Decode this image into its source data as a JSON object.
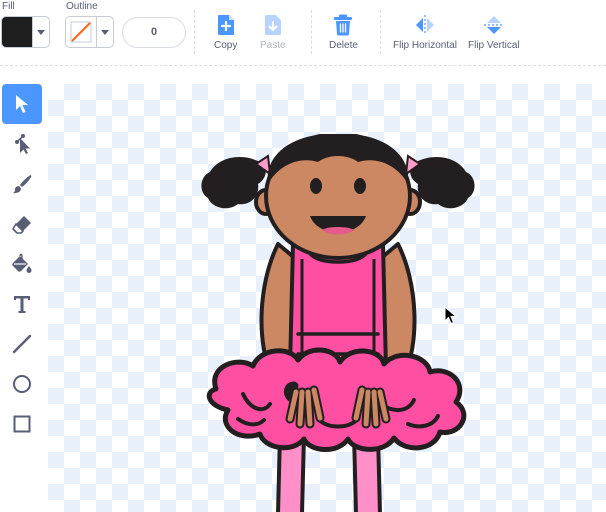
{
  "toolbar": {
    "fill_label": "Fill",
    "outline_label": "Outline",
    "fill_color": "#1e1e1e",
    "outline_color": "none",
    "outline_width": "0",
    "copy_label": "Copy",
    "paste_label": "Paste",
    "delete_label": "Delete",
    "flip_h_label": "Flip Horizontal",
    "flip_v_label": "Flip Vertical"
  },
  "palette": {
    "items": [
      "select-tool",
      "reshape-tool",
      "brush-tool",
      "eraser-tool",
      "fill-tool",
      "text-tool",
      "line-tool",
      "circle-tool",
      "rectangle-tool"
    ],
    "active": "select-tool"
  },
  "colors": {
    "accent": "#4c97ff",
    "skin": "#cc8763",
    "hair": "#231f20",
    "dress": "#ff4fa3",
    "dress_dark": "#e63f8d",
    "legs": "#ff8fc8",
    "bow": "#ff9ccc",
    "delete": "#4c97ff"
  }
}
